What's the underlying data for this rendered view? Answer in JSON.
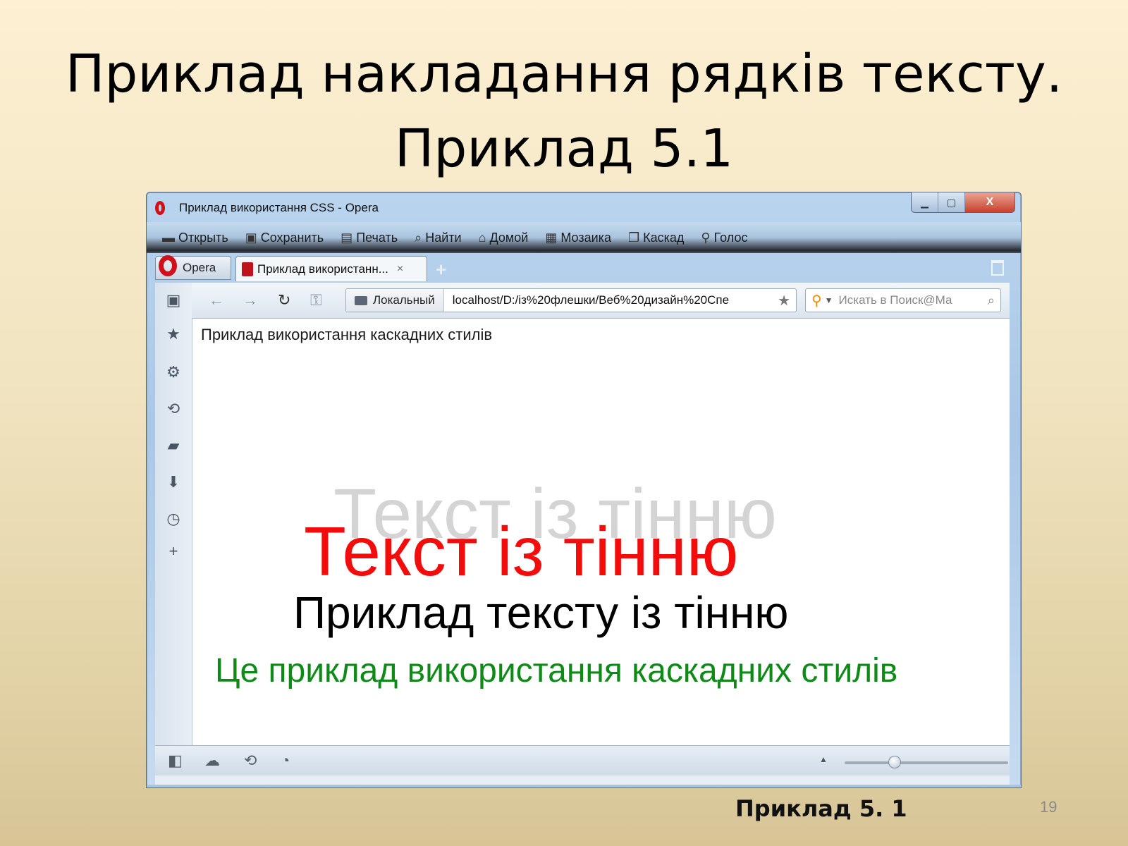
{
  "slide": {
    "title_line1": "Приклад накладання рядків тексту.",
    "title_line2": "Приклад 5.1",
    "caption": "Приклад 5. 1",
    "page_number": "19"
  },
  "browser": {
    "window_title": "Приклад використання CSS - Opera",
    "window_controls": {
      "minimize": "▁",
      "maximize": "▢",
      "close": "X"
    },
    "menu": [
      {
        "label": "Открыть",
        "icon": "folder-icon"
      },
      {
        "label": "Сохранить",
        "icon": "save-icon"
      },
      {
        "label": "Печать",
        "icon": "print-icon"
      },
      {
        "label": "Найти",
        "icon": "find-icon"
      },
      {
        "label": "Домой",
        "icon": "home-icon"
      },
      {
        "label": "Мозаика",
        "icon": "tile-icon"
      },
      {
        "label": "Каскад",
        "icon": "cascade-icon"
      },
      {
        "label": "Голос",
        "icon": "microphone-icon"
      }
    ],
    "tabs": {
      "opera_tab": "Opera",
      "active_tab": "Приклад використанн...",
      "close_glyph": "×",
      "new_tab_glyph": "+"
    },
    "address": {
      "security_label": "Локальный",
      "url": "localhost/D:/із%20флешки/Веб%20дизайн%20Спе"
    },
    "search": {
      "placeholder": "Искать в Поиск@Ма"
    },
    "zoom_level": 0.3
  },
  "page": {
    "heading": "Приклад використання каскадних стилів",
    "shadow_text": "Текст із тінню",
    "red_text": "Текст із тінню",
    "black_text": "Приклад тексту із тінню",
    "green_text": "Це приклад використання каскадних стилів"
  },
  "colors": {
    "red_text": "#f20c0c",
    "shadow_text": "#d4d4d4",
    "green_text": "#0e8a17",
    "opera_red": "#d0111b"
  }
}
